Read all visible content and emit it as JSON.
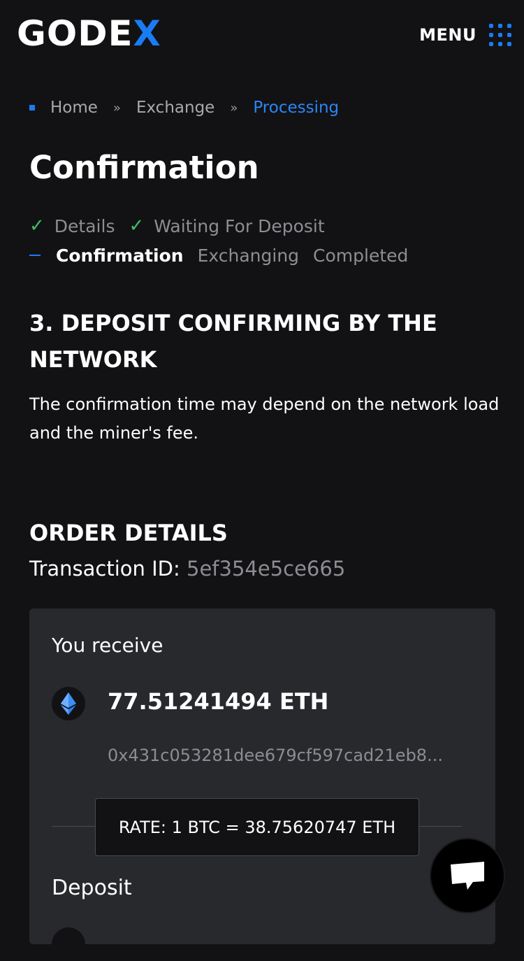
{
  "header": {
    "logo_main": "GODE",
    "logo_accent": "X",
    "menu_label": "MENU"
  },
  "breadcrumb": {
    "items": [
      "Home",
      "Exchange",
      "Processing"
    ]
  },
  "page_title": "Confirmation",
  "steps": {
    "done": [
      "Details",
      "Waiting For Deposit"
    ],
    "current": "Confirmation",
    "upcoming": [
      "Exchanging",
      "Completed"
    ]
  },
  "section": {
    "heading": "3. DEPOSIT CONFIRMING BY THE NETWORK",
    "description": "The confirmation time may depend on the network load and the miner's fee."
  },
  "order": {
    "heading": "ORDER DETAILS",
    "txid_label": "Transaction ID:",
    "txid_value": "5ef354e5ce665"
  },
  "receive": {
    "label": "You receive",
    "amount": "77.51241494 ETH",
    "address": "0x431c053281dee679cf597cad21eb8..."
  },
  "rate": "RATE: 1 BTC = 38.75620747 ETH",
  "deposit": {
    "label": "Deposit"
  },
  "colors": {
    "accent": "#1a7cf5",
    "background": "#121214",
    "card": "#28292d",
    "check": "#3fbf6b"
  },
  "icons": {
    "menu": "grid-dots-icon",
    "coin": "ethereum-icon",
    "chat": "chat-bubble-icon",
    "step_done": "check-icon"
  }
}
